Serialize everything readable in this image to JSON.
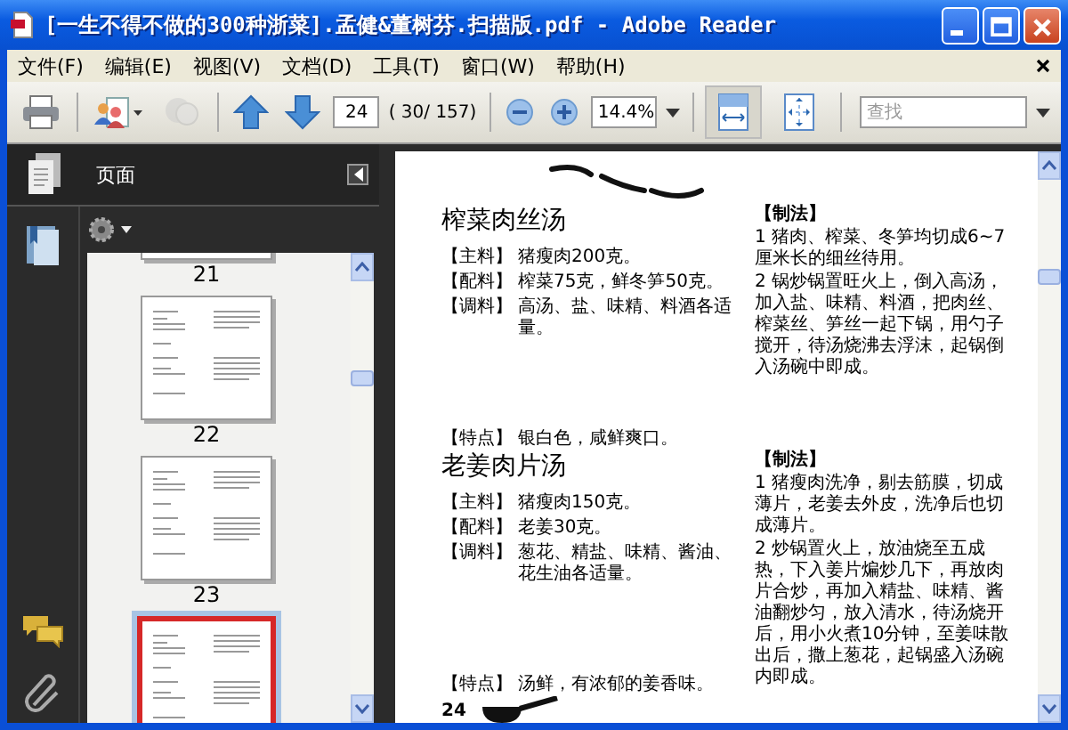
{
  "window": {
    "title": "[一生不得不做的300种浙菜].孟健&董树芬.扫描版.pdf - Adobe Reader"
  },
  "menu": [
    "文件(F)",
    "编辑(E)",
    "视图(V)",
    "文档(D)",
    "工具(T)",
    "窗口(W)",
    "帮助(H)"
  ],
  "toolbar": {
    "page_number": "24",
    "page_count": "( 30/ 157)",
    "zoom": "14.4%",
    "search": {
      "placeholder": "查找"
    },
    "tools": [
      {
        "kind": "print",
        "disabled": false
      },
      {
        "kind": "share",
        "disabled": false
      },
      {
        "kind": "sync",
        "disabled": true
      },
      {
        "kind": "prev",
        "disabled": false
      },
      {
        "kind": "next",
        "disabled": false
      }
    ],
    "view_tools": [
      {
        "kind": "fit-width",
        "selected": true
      },
      {
        "kind": "fit-page",
        "selected": false
      }
    ]
  },
  "sidebar": {
    "title": "页面",
    "thumbnails": [
      {
        "label": "21",
        "selected": false
      },
      {
        "label": "22",
        "selected": false
      },
      {
        "label": "23",
        "selected": false
      },
      {
        "selected": true
      }
    ]
  },
  "document": {
    "recipes": [
      {
        "title": "榨菜肉丝汤",
        "fields": [
          {
            "name": "【主料】",
            "value": "猪瘦肉200克。"
          },
          {
            "name": "【配料】",
            "value": "榨菜75克，鲜冬笋50克。"
          },
          {
            "name": "【调料】",
            "value": "高汤、盐、味精、料酒各适量。"
          }
        ],
        "feature": {
          "name": "【特点】",
          "value": "银白色，咸鲜爽口。"
        },
        "method_title": "【制法】",
        "steps": [
          "1 猪肉、榨菜、冬笋均切成6~7厘米长的细丝待用。",
          "2 锅炒锅置旺火上，倒入高汤，加入盐、味精、料酒，把肉丝、榨菜丝、笋丝一起下锅，用勺子搅开，待汤烧沸去浮沫，起锅倒入汤碗中即成。"
        ]
      },
      {
        "title": "老姜肉片汤",
        "fields": [
          {
            "name": "【主料】",
            "value": "猪瘦肉150克。"
          },
          {
            "name": "【配料】",
            "value": "老姜30克。"
          },
          {
            "name": "【调料】",
            "value": "葱花、精盐、味精、酱油、花生油各适量。"
          }
        ],
        "feature": {
          "name": "【特点】",
          "value": "汤鲜，有浓郁的姜香味。"
        },
        "method_title": "【制法】",
        "steps": [
          "1 猪瘦肉洗净，剔去筋膜，切成薄片，老姜去外皮，洗净后也切成薄片。",
          "2 炒锅置火上，放油烧至五成热，下入姜片煸炒几下，再放肉片合炒，再加入精盐、味精、酱油翻炒匀，放入清水，待汤烧开后，用小火煮10分钟，至姜味散出后，撒上葱花，起锅盛入汤碗内即成。"
        ]
      }
    ],
    "page_number": "24"
  }
}
